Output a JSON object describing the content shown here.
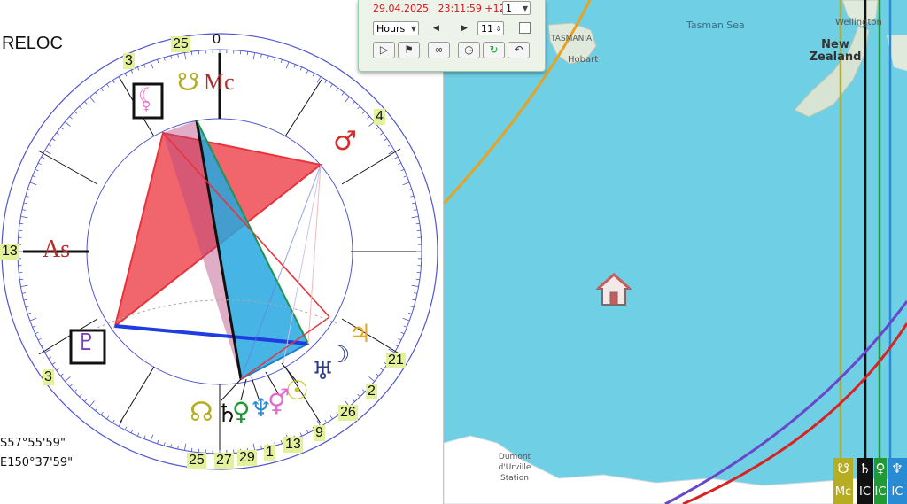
{
  "toolbar": {
    "date": "29.04.2025",
    "time": "23:11:59 +12",
    "speed_select": "1",
    "unit_select": "Hours",
    "step_value": "11",
    "colors": {
      "date_text": "#d01616",
      "panel_bg": "#eef3e9"
    }
  },
  "chart": {
    "title": "RELOC",
    "latitude": "S57°55'59\"",
    "longitude": "E150°37'59\"",
    "house_labels": {
      "asc_degree": "13",
      "mc_degree": "0",
      "cusp_11": "25",
      "cusp_12": "3",
      "cusp_9": "4",
      "cusp_2": "3",
      "cusp_8": "21"
    },
    "angle_labels": {
      "asc": "As",
      "mc": "Mc"
    },
    "planet_degrees": [
      "25",
      "27",
      "29",
      "1",
      "13",
      "9",
      "26",
      "2"
    ],
    "colors": {
      "aspect_red": "#e8333b",
      "aspect_blue": "#26a7e0",
      "ring": "#4f55cf",
      "label_bg": "#e3f29a"
    }
  },
  "map": {
    "labels": {
      "tasmania": "TASMANIA",
      "hobart": "Hobart",
      "tasman_sea": "Tasman Sea",
      "wellington": "Wellington",
      "new_zealand": "New Zealand",
      "dumont": "Dumont d'Urville Station"
    },
    "legend": [
      {
        "top": "☋",
        "bottom": "Mc",
        "color": "#b6ad23"
      },
      {
        "top": "♄",
        "bottom": "IC",
        "color": "#111111"
      },
      {
        "top": "♀",
        "bottom": "IC",
        "color": "#1f9a34"
      },
      {
        "top": "♆",
        "bottom": "IC",
        "color": "#2a8bd5"
      }
    ],
    "colors": {
      "ocean": "#6fcfe4",
      "land": "#dfe9dc"
    }
  }
}
